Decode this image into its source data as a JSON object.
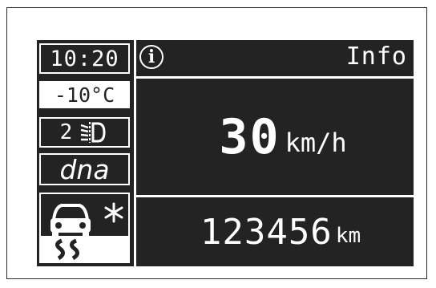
{
  "left_column": {
    "time": "10:20",
    "outside_temp": "-10°C",
    "light_level": "2",
    "light_icon": "headlight-level-icon",
    "drive_mode": "dna",
    "warning_icons": [
      "slippery-road-car-icon",
      "snowflake-icon"
    ]
  },
  "header": {
    "info_icon_glyph": "i",
    "label": "Info"
  },
  "speed": {
    "value": "30",
    "unit": "km/h"
  },
  "odometer": {
    "value": "123456",
    "unit": "km"
  },
  "colors": {
    "display_bg": "#232323",
    "foreground": "#ffffff"
  }
}
